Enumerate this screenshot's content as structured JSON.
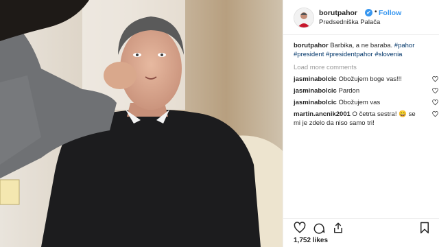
{
  "header": {
    "username": "borutpahor",
    "verified_mark": "✔",
    "dot": "•",
    "follow_label": "Follow",
    "location": "Predsedniška Palača"
  },
  "caption": {
    "username": "borutpahor",
    "text": " Barbika, a ne baraba. ",
    "tag_pahor": "#pahor",
    "tag_president": "#president",
    "tag_presidentpahor": "#presidentpahor",
    "tag_slovenia": "#slovenia"
  },
  "load_more": "Load more comments",
  "comments": [
    {
      "username": "jasminabolcic",
      "text": " Obožujem boge vas!!!"
    },
    {
      "username": "jasminabolcic",
      "text": " Pardon"
    },
    {
      "username": "jasminabolcic",
      "text": " Obožujem vas"
    },
    {
      "username": "martin.ancnik2001",
      "text": " O četrta sestra! 😄 se mi je zdelo da niso samo tri!"
    }
  ],
  "likes": "1,752 likes",
  "icons": {
    "heart": "heart-icon",
    "comment": "comment-icon",
    "share": "share-icon",
    "bookmark": "bookmark-icon",
    "verified": "verified-badge-icon"
  },
  "colors": {
    "link": "#3897f0",
    "hashtag": "#003569",
    "muted": "#999999",
    "text": "#262626"
  }
}
